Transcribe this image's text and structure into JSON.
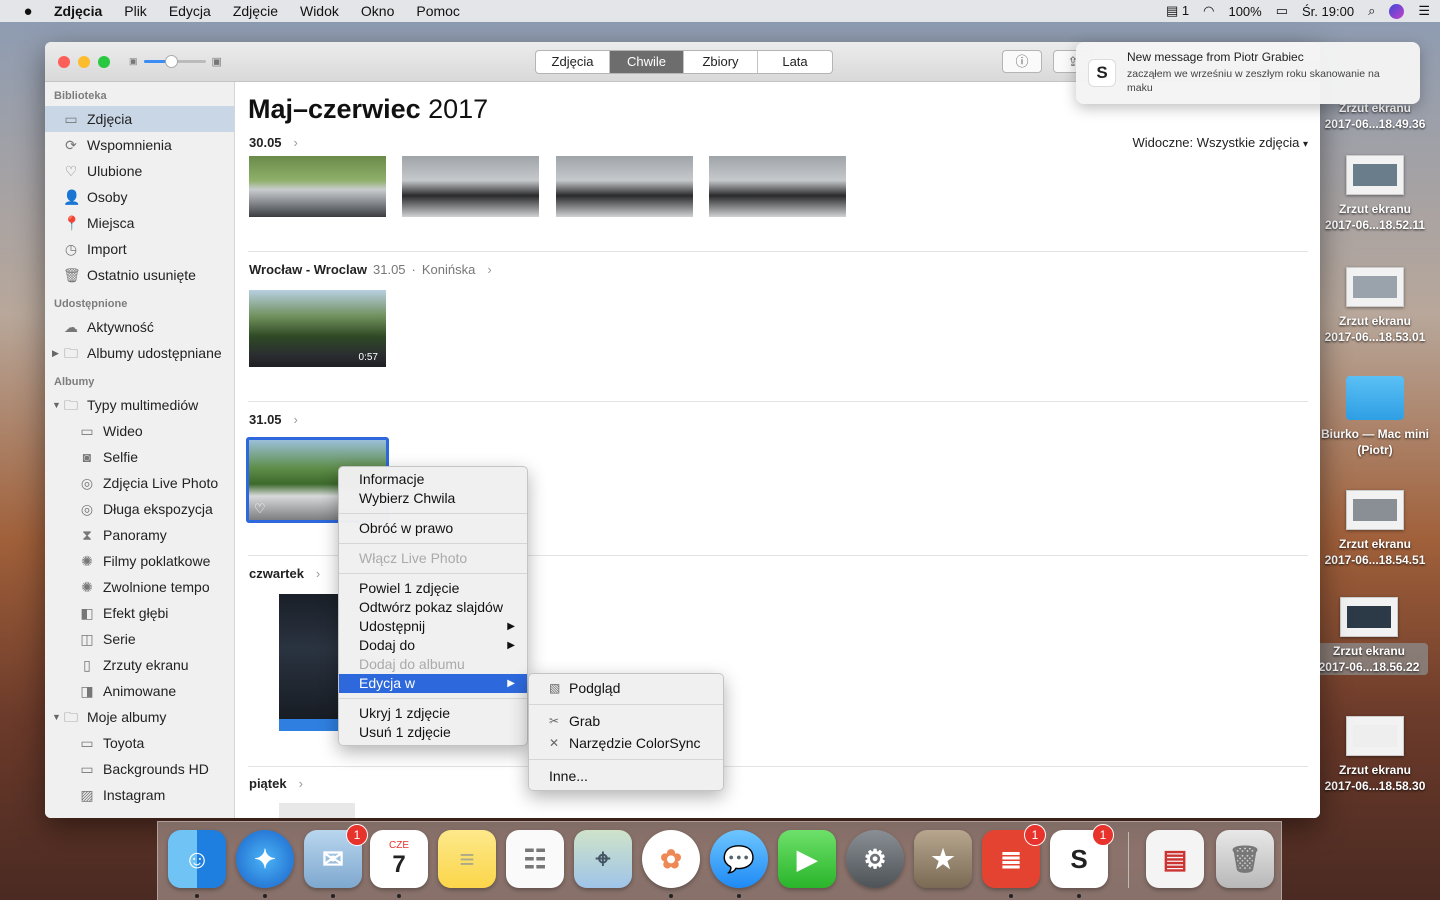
{
  "menubar": {
    "app": "Zdjęcia",
    "items": [
      "Plik",
      "Edycja",
      "Zdjęcie",
      "Widok",
      "Okno",
      "Pomoc"
    ],
    "status": {
      "display_count": "1",
      "battery": "100%",
      "clock": "Śr. 19:00"
    }
  },
  "toolbar": {
    "tabs": [
      "Zdjęcia",
      "Chwile",
      "Zbiory",
      "Lata"
    ],
    "active_tab": "Chwile",
    "zoom_level": 0.45
  },
  "sidebar": {
    "library_header": "Biblioteka",
    "library": [
      {
        "label": "Zdjęcia",
        "icon": "photos-icon",
        "glyph": "▭"
      },
      {
        "label": "Wspomnienia",
        "icon": "memories-icon",
        "glyph": "⟳"
      },
      {
        "label": "Ulubione",
        "icon": "heart-icon",
        "glyph": "♡"
      },
      {
        "label": "Osoby",
        "icon": "person-icon",
        "glyph": "👤"
      },
      {
        "label": "Miejsca",
        "icon": "pin-icon",
        "glyph": "📍"
      },
      {
        "label": "Import",
        "icon": "clock-icon",
        "glyph": "◷"
      },
      {
        "label": "Ostatnio usunięte",
        "icon": "trash-icon",
        "glyph": "🗑"
      }
    ],
    "shared_header": "Udostępnione",
    "shared": [
      {
        "label": "Aktywność",
        "icon": "cloud-icon",
        "glyph": "☁"
      },
      {
        "label": "Albumy udostępniane",
        "icon": "folder-icon",
        "glyph": "🗀"
      }
    ],
    "albums_header": "Albumy",
    "media_types": "Typy multimediów",
    "media": [
      {
        "label": "Wideo",
        "icon": "video-icon",
        "glyph": "▭"
      },
      {
        "label": "Selfie",
        "icon": "camera-icon",
        "glyph": "◙"
      },
      {
        "label": "Zdjęcia Live Photo",
        "icon": "live-photo-icon",
        "glyph": "◎"
      },
      {
        "label": "Długa ekspozycja",
        "icon": "long-exposure-icon",
        "glyph": "◎"
      },
      {
        "label": "Panoramy",
        "icon": "panorama-icon",
        "glyph": "⧗"
      },
      {
        "label": "Filmy poklatkowe",
        "icon": "timelapse-icon",
        "glyph": "✺"
      },
      {
        "label": "Zwolnione tempo",
        "icon": "slowmo-icon",
        "glyph": "✺"
      },
      {
        "label": "Efekt głębi",
        "icon": "depth-icon",
        "glyph": "◧"
      },
      {
        "label": "Serie",
        "icon": "burst-icon",
        "glyph": "◫"
      },
      {
        "label": "Zrzuty ekranu",
        "icon": "screenshot-icon",
        "glyph": "▯"
      },
      {
        "label": "Animowane",
        "icon": "animated-icon",
        "glyph": "◨"
      }
    ],
    "my_albums": "Moje albumy",
    "albums": [
      {
        "label": "Toyota",
        "icon": "album-icon",
        "glyph": "▭"
      },
      {
        "label": "Backgrounds HD",
        "icon": "album-icon",
        "glyph": "▭"
      },
      {
        "label": "Instagram",
        "icon": "album-icon",
        "glyph": "▨"
      }
    ]
  },
  "content": {
    "title_bold": "Maj–czerwiec",
    "title_year": "2017",
    "filter": "Widoczne: Wszystkie zdjęcia",
    "sections": [
      {
        "title": "30.05",
        "meta": "",
        "meta2": ""
      },
      {
        "title": "Wrocław - Wroclaw",
        "meta": "31.05",
        "meta2": "Konińska"
      },
      {
        "title": "31.05",
        "meta": "",
        "meta2": ""
      },
      {
        "title": "czwartek",
        "meta": "",
        "meta2": ""
      },
      {
        "title": "piątek",
        "meta": "",
        "meta2": ""
      }
    ],
    "video_duration": "0:57"
  },
  "context_menu": {
    "info": "Informacje",
    "choose": "Wybierz Chwila",
    "rotate": "Obróć w prawo",
    "live": "Włącz Live Photo",
    "duplicate": "Powiel 1 zdjęcie",
    "slideshow": "Odtwórz pokaz slajdów",
    "share": "Udostępnij",
    "add_to": "Dodaj do",
    "add_album": "Dodaj do albumu",
    "edit_with": "Edycja w",
    "hide": "Ukryj 1 zdjęcie",
    "delete": "Usuń 1 zdjęcie"
  },
  "submenu": {
    "preview": "Podgląd",
    "grab": "Grab",
    "colorsync": "Narzędzie ColorSync",
    "other": "Inne..."
  },
  "notification": {
    "title": "New message from Piotr Grabiec",
    "body": "zacząłem we wrześniu w zeszłym roku skanowanie na maku",
    "app_letter": "S"
  },
  "desktop": [
    {
      "name": "Zrzut ekranu",
      "sub": "2017-06...18.49.36"
    },
    {
      "name": "Zrzut ekranu",
      "sub": "2017-06...18.52.11"
    },
    {
      "name": "Zrzut ekranu",
      "sub": "2017-06...18.53.01"
    },
    {
      "name": "Biurko — Mac mini",
      "sub": "(Piotr)"
    },
    {
      "name": "Zrzut ekranu",
      "sub": "2017-06...18.54.51"
    },
    {
      "name": "Zrzut ekranu",
      "sub": "2017-06...18.56.22"
    },
    {
      "name": "Zrzut ekranu",
      "sub": "2017-06...18.58.30"
    }
  ],
  "dock": {
    "calendar_month": "CZE",
    "calendar_day": "7",
    "badge_mail": "1",
    "badge_todoist": "1",
    "badge_slack": "1",
    "slack_letter": "S"
  },
  "colors": {
    "accent": "#2d69dc",
    "selection": "#c9d6e6",
    "close": "#fc5f57",
    "minimize": "#fdbb2e",
    "zoom": "#28c840"
  }
}
